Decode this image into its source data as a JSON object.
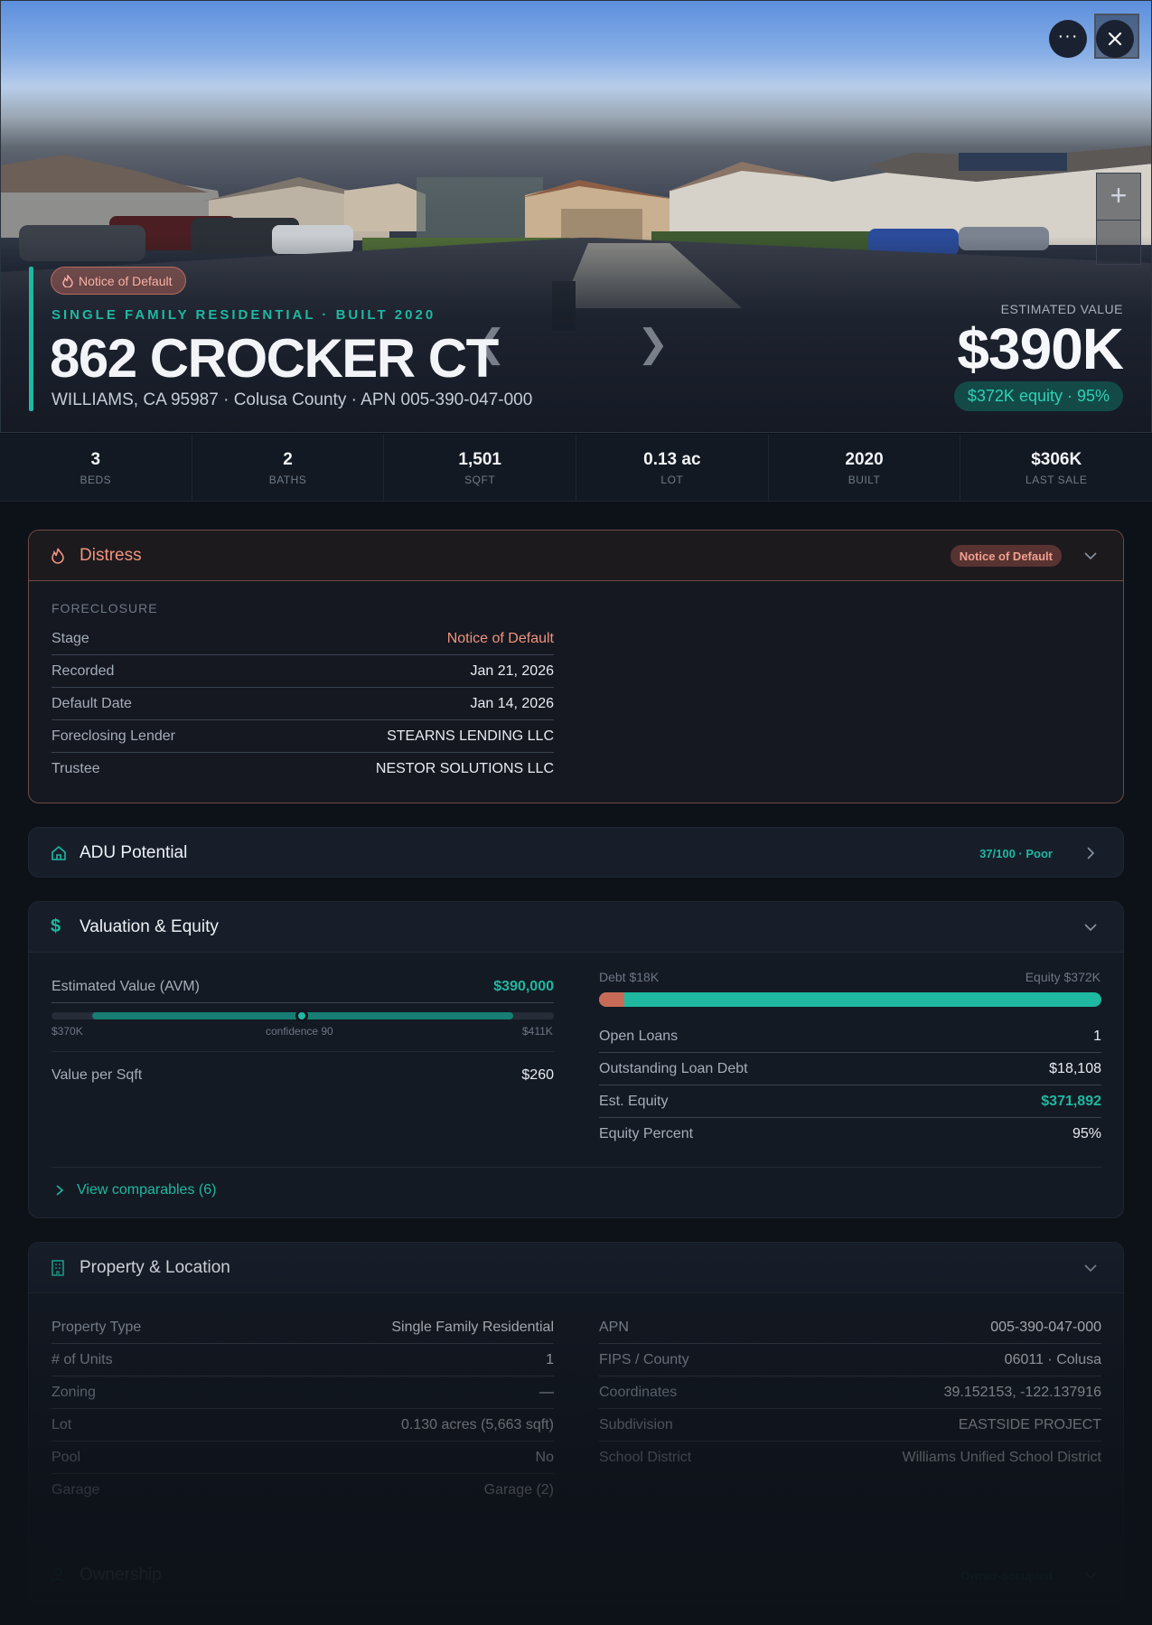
{
  "hero": {
    "badge": "Notice of Default",
    "property_type": "SINGLE FAMILY RESIDENTIAL · BUILT 2020",
    "address": "862 CROCKER CT",
    "address_sub": "WILLIAMS, CA 95987 · Colusa County · APN 005-390-047-000",
    "est_label": "ESTIMATED VALUE",
    "est_value": "$390K",
    "equity_pill": "$372K equity · 95%"
  },
  "stats": [
    {
      "value": "3",
      "label": "BEDS"
    },
    {
      "value": "2",
      "label": "BATHS"
    },
    {
      "value": "1,501",
      "label": "SQFT"
    },
    {
      "value": "0.13 ac",
      "label": "LOT"
    },
    {
      "value": "2020",
      "label": "BUILT"
    },
    {
      "value": "$306K",
      "label": "LAST SALE"
    }
  ],
  "distress": {
    "title": "Distress",
    "pill": "Notice of Default",
    "section": "FORECLOSURE",
    "rows": [
      {
        "k": "Stage",
        "v": "Notice of Default"
      },
      {
        "k": "Recorded",
        "v": "Jan 21, 2026"
      },
      {
        "k": "Default Date",
        "v": "Jan 14, 2026"
      },
      {
        "k": "Foreclosing Lender",
        "v": "STEARNS LENDING LLC"
      },
      {
        "k": "Trustee",
        "v": "NESTOR SOLUTIONS LLC"
      }
    ]
  },
  "adu": {
    "title": "ADU Potential",
    "score": "37/100 · Poor"
  },
  "valuation": {
    "title": "Valuation & Equity",
    "avm_label": "Estimated Value (AVM)",
    "avm_value": "$390,000",
    "range_low": "$370K",
    "confidence": "confidence 90",
    "range_high": "$411K",
    "confidence_score": 90,
    "vps_label": "Value per Sqft",
    "vps_value": "$260",
    "debt_label": "Debt $18K",
    "equity_label": "Equity $372K",
    "equity_fraction": 0.95,
    "rows": [
      {
        "k": "Open Loans",
        "v": "1"
      },
      {
        "k": "Outstanding Loan Debt",
        "v": "$18,108"
      },
      {
        "k": "Est. Equity",
        "v": "$371,892"
      },
      {
        "k": "Equity Percent",
        "v": "95%"
      }
    ],
    "comparables": "View comparables (6)"
  },
  "property": {
    "title": "Property & Location",
    "left": [
      {
        "k": "Property Type",
        "v": "Single Family Residential"
      },
      {
        "k": "# of Units",
        "v": "1"
      },
      {
        "k": "Zoning",
        "v": "—"
      },
      {
        "k": "Lot",
        "v": "0.130 acres (5,663 sqft)"
      },
      {
        "k": "Pool",
        "v": "No"
      },
      {
        "k": "Garage",
        "v": "Garage (2)"
      }
    ],
    "right": [
      {
        "k": "APN",
        "v": "005-390-047-000"
      },
      {
        "k": "FIPS / County",
        "v": "06011 · Colusa"
      },
      {
        "k": "Coordinates",
        "v": "39.152153, -122.137916"
      },
      {
        "k": "Subdivision",
        "v": "EASTSIDE PROJECT"
      },
      {
        "k": "School District",
        "v": "Williams Unified School District"
      }
    ]
  },
  "ownership": {
    "title": "Ownership",
    "pill": "Owner-occupied"
  },
  "colors": {
    "accent": "#1fb8a0",
    "distress": "#f0937e",
    "debt": "#c86a58",
    "background": "#0d1118"
  }
}
